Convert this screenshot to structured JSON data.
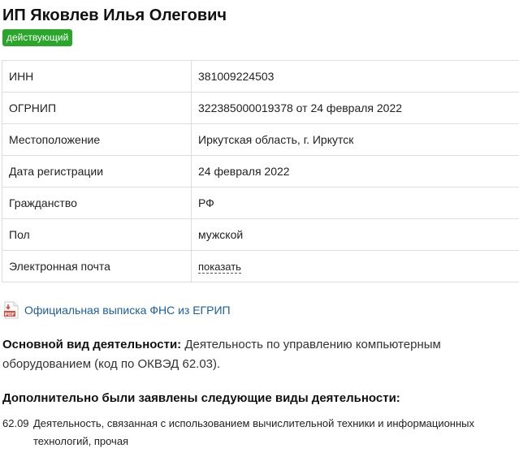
{
  "header": {
    "title": "ИП Яковлев Илья Олегович",
    "status": "действующий",
    "status_color": "#2aa62a"
  },
  "details": [
    {
      "label": "ИНН",
      "value": "381009224503"
    },
    {
      "label": "ОГРНИП",
      "value": "322385000019378 от 24 февраля 2022"
    },
    {
      "label": "Местоположение",
      "value": "Иркутская область, г. Иркутск"
    },
    {
      "label": "Дата регистрации",
      "value": "24 февраля 2022"
    },
    {
      "label": "Гражданство",
      "value": "РФ"
    },
    {
      "label": "Пол",
      "value": "мужской"
    },
    {
      "label": "Электронная почта",
      "value": "показать"
    }
  ],
  "extract": {
    "icon": "pdf-file-icon",
    "link_text": "Официальная выписка ФНС из ЕГРИП",
    "link_color": "#1a5f9e"
  },
  "main_activity": {
    "label": "Основной вид деятельности:",
    "text": "Деятельность по управлению компьютерным оборудованием (код по ОКВЭД 62.03)."
  },
  "additional": {
    "heading": "Дополнительно были заявлены следующие виды деятельности:",
    "items": [
      {
        "code": "62.09",
        "text": "Деятельность, связанная с использованием вычислительной техники и информационных технологий, прочая"
      }
    ]
  }
}
